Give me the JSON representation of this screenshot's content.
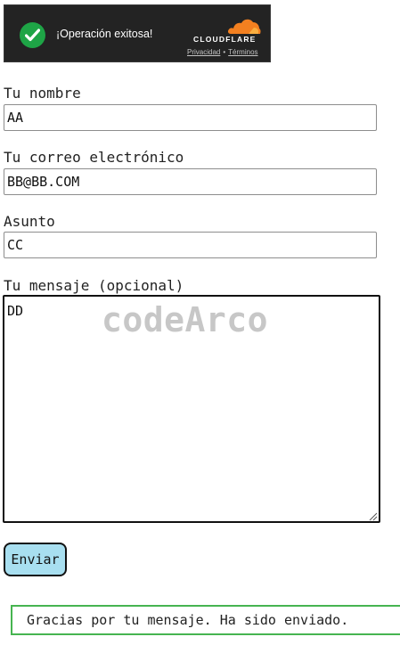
{
  "captcha": {
    "status_text": "¡Operación exitosa!",
    "brand": "CLOUDFLARE",
    "privacy_link": "Privacidad",
    "separator": "•",
    "terms_link": "Términos",
    "colors": {
      "background": "#232323",
      "check": "#1ea446",
      "cloud": "#f38020"
    }
  },
  "form": {
    "name": {
      "label": "Tu nombre",
      "value": "AA"
    },
    "email": {
      "label": "Tu correo electrónico",
      "value": "BB@BB.COM"
    },
    "subject": {
      "label": "Asunto",
      "value": "CC"
    },
    "message": {
      "label": "Tu mensaje (opcional)",
      "value": "DD"
    },
    "watermark": "codeArco",
    "submit_label": "Enviar",
    "submit_color": "#a8dff0"
  },
  "response": {
    "message": "Gracias por tu mensaje. Ha sido enviado.",
    "border_color": "#46b450"
  }
}
